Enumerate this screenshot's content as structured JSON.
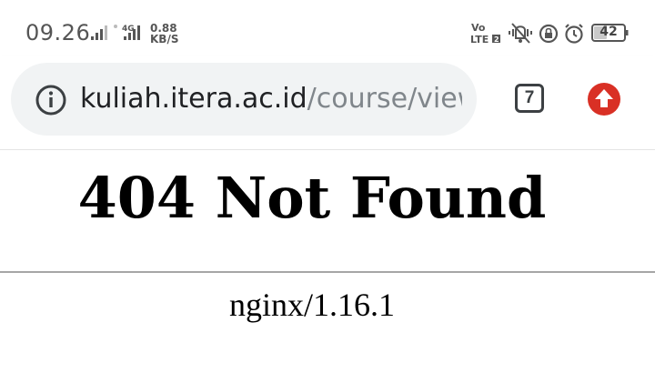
{
  "status_bar": {
    "time": "09.26",
    "net_speed_value": "0.88",
    "net_speed_unit": "KB/S",
    "network_type": "4G",
    "volte_label_top": "Vo",
    "volte_label_bottom": "LTE",
    "battery_level": "42",
    "icons": [
      "signal-bars-icon",
      "wifi-calling-icon",
      "4g-signal-bars-icon",
      "volte-icon",
      "vibrate-icon",
      "do-not-disturb-icon",
      "alarm-icon",
      "battery-icon"
    ]
  },
  "toolbar": {
    "url_domain": "kuliah.itera.ac.id",
    "url_path": "/course/view",
    "tab_count": "7",
    "icons": {
      "site_info": "info-icon",
      "update": "update-arrow-icon"
    },
    "update_color": "#d93025"
  },
  "page": {
    "heading": "404 Not Found",
    "server": "nginx/1.16.1"
  }
}
